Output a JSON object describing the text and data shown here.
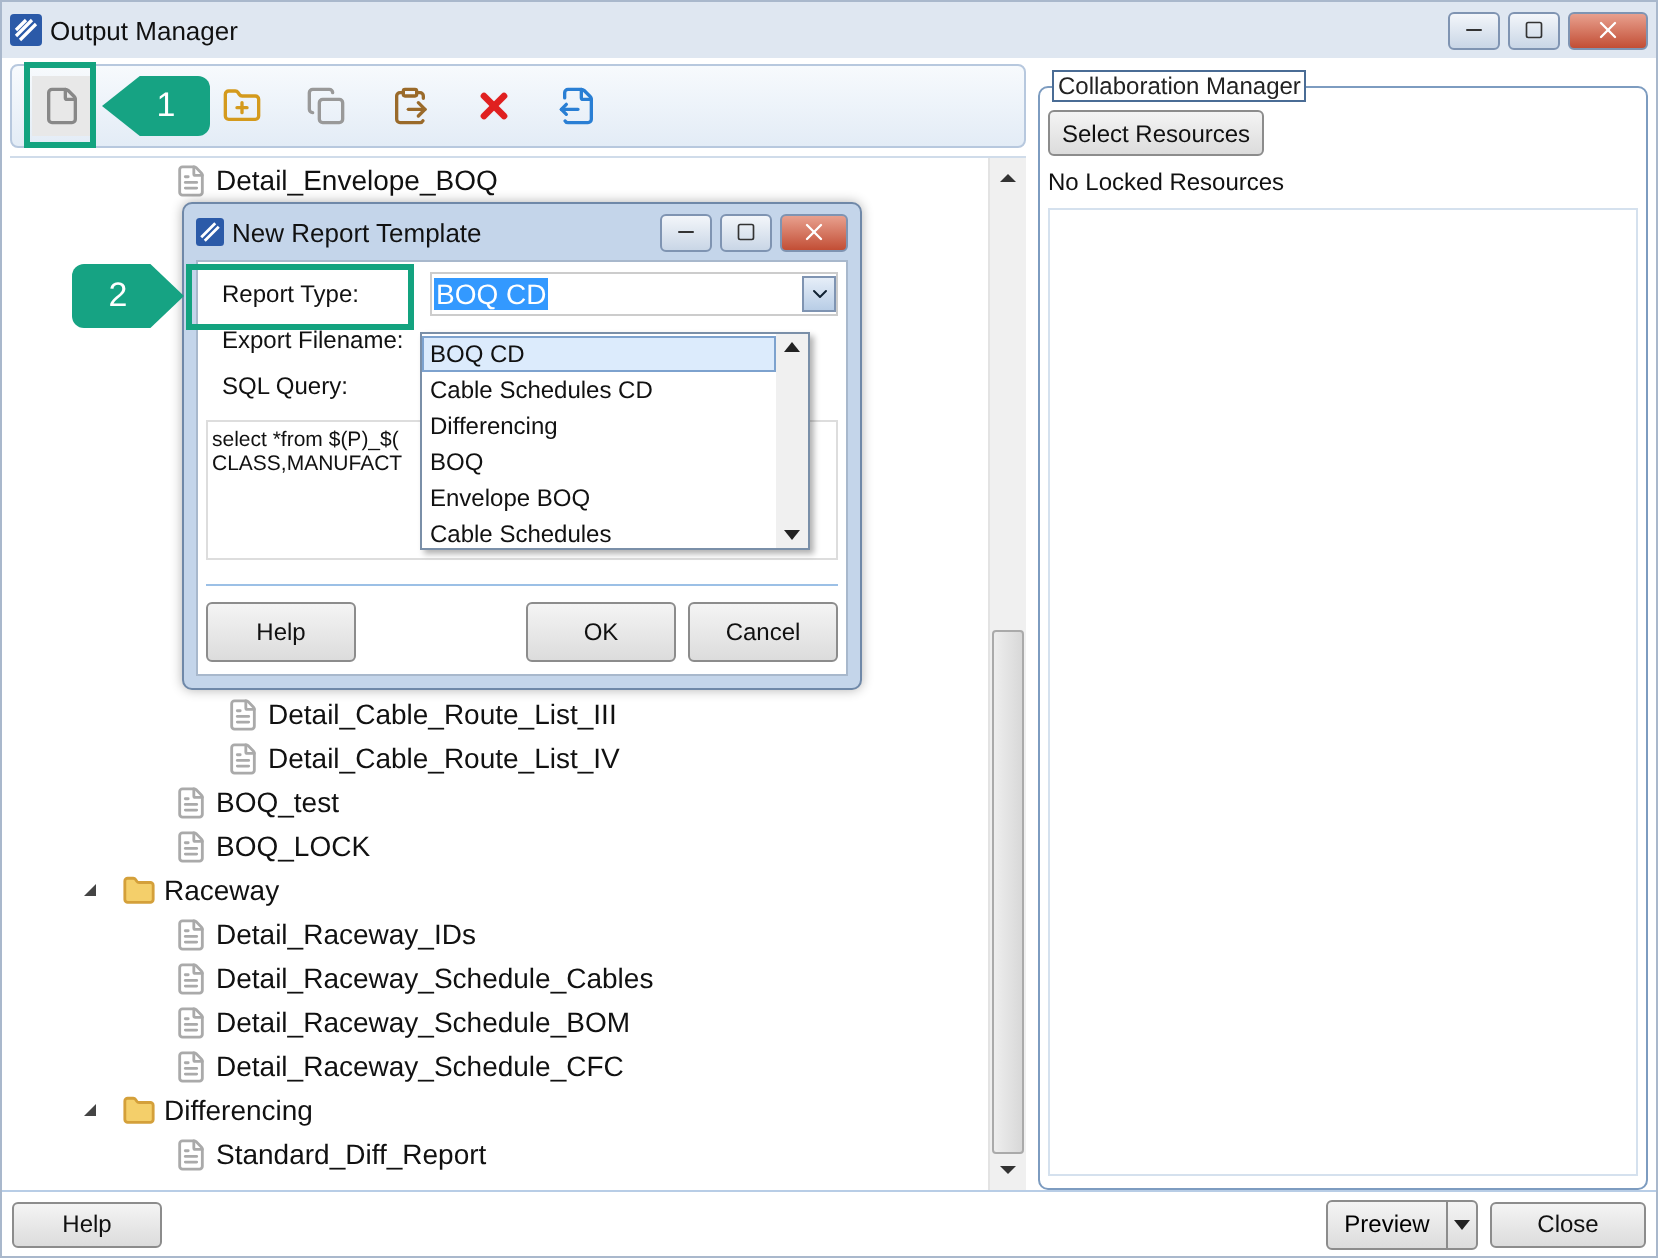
{
  "window": {
    "title": "Output Manager"
  },
  "toolbar": [
    {
      "kind": "new",
      "highlighted": true
    },
    {
      "kind": "add-folder",
      "highlighted": false
    },
    {
      "kind": "copy",
      "highlighted": false
    },
    {
      "kind": "paste",
      "highlighted": false
    },
    {
      "kind": "delete",
      "highlighted": false
    },
    {
      "kind": "export",
      "highlighted": false
    }
  ],
  "tree": [
    {
      "children": [
        {
          "label": "Detail_Envelope_BOQ",
          "kind": "report"
        },
        {
          "children": [
            {
              "label": "Detail_Cable_Route_List_III",
              "kind": "report"
            },
            {
              "label": "Detail_Cable_Route_List_IV",
              "kind": "report"
            }
          ]
        },
        {
          "label": "BOQ_test",
          "kind": "report"
        },
        {
          "label": "BOQ_LOCK",
          "kind": "report"
        }
      ]
    },
    {
      "label": "Raceway",
      "kind": "folder",
      "expanded": true,
      "children": [
        {
          "label": "Detail_Raceway_IDs",
          "kind": "report"
        },
        {
          "label": "Detail_Raceway_Schedule_Cables",
          "kind": "report"
        },
        {
          "label": "Detail_Raceway_Schedule_BOM",
          "kind": "report"
        },
        {
          "label": "Detail_Raceway_Schedule_CFC",
          "kind": "report"
        }
      ]
    },
    {
      "label": "Differencing",
      "kind": "folder",
      "expanded": true,
      "children": [
        {
          "label": "Standard_Diff_Report",
          "kind": "report"
        }
      ]
    }
  ],
  "collaboration": {
    "title": "Collaboration Manager",
    "button": "Select Resources",
    "status": "No Locked Resources"
  },
  "footer": {
    "help": "Help",
    "preview": "Preview",
    "close": "Close"
  },
  "dialog": {
    "title": "New Report Template",
    "fields": [
      {
        "label": "Report Type:",
        "value": "BOQ CD"
      },
      {
        "label": "Export Filename:"
      },
      {
        "label": "SQL Query:"
      }
    ],
    "query_lines": [
      "select *from $(P)_$(",
      "CLASS,MANUFACT"
    ],
    "dropdown": [
      {
        "label": "BOQ CD",
        "selected": true
      },
      {
        "label": "Cable Schedules CD",
        "selected": false
      },
      {
        "label": "Differencing",
        "selected": false
      },
      {
        "label": "BOQ",
        "selected": false
      },
      {
        "label": "Envelope BOQ",
        "selected": false
      },
      {
        "label": "Cable Schedules",
        "selected": false
      }
    ],
    "buttons": {
      "help": "Help",
      "ok": "OK",
      "cancel": "Cancel"
    }
  },
  "callouts": [
    {
      "text": "1"
    },
    {
      "text": "2"
    }
  ]
}
